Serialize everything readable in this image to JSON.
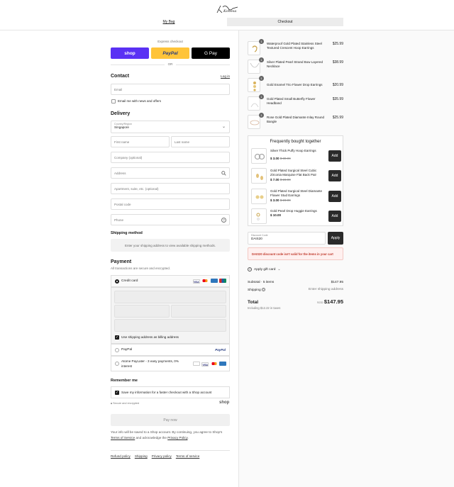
{
  "header": {
    "logo_text": "Kohesa",
    "tab_bag": "My Bag",
    "tab_checkout": "Checkout"
  },
  "express": {
    "title": "Express checkout",
    "shop_label": "shop",
    "paypal_label": "PayPal",
    "gpay_label": "G Pay",
    "or_label": "OR"
  },
  "contact": {
    "title": "Contact",
    "login_link": "Log in",
    "email_placeholder": "Email",
    "news_label": "Email me with news and offers"
  },
  "delivery": {
    "title": "Delivery",
    "country_label": "Country/Region",
    "country_value": "Singapore",
    "first_name": "First name",
    "last_name": "Last name",
    "company": "Company (optional)",
    "address": "Address",
    "apartment": "Apartment, suite, etc. (optional)",
    "postal": "Postal code",
    "phone": "Phone"
  },
  "shipping": {
    "title": "Shipping method",
    "notice": "Enter your shipping address to view available shipping methods."
  },
  "payment": {
    "title": "Payment",
    "subtitle": "All transactions are secure and encrypted.",
    "credit_card": "Credit card",
    "billing_same": "Use shipping address as billing address",
    "paypal": "PayPal",
    "paypal_logo": "PayPal",
    "atome": "Atome PayLater - 3 easy payments, 0% interest"
  },
  "remember": {
    "title": "Remember me",
    "save_label": "Save my information for a faster checkout with a Shop account",
    "secure_note": "Secure and encrypted",
    "shop_logo": "shop"
  },
  "pay_button": "Pay now",
  "legal": {
    "line1": "Your info will be saved to a Shop account. By continuing, you agree to Shop's",
    "terms": "Terms of Service",
    "and": "and acknowledge the",
    "privacy": "Privacy Policy",
    "dot": "."
  },
  "footer": {
    "refund": "Refund policy",
    "shipping": "Shipping",
    "privacy": "Privacy policy",
    "terms": "Terms of service"
  },
  "cart": {
    "items": [
      {
        "qty": "1",
        "name": "Waterproof Gold Plated Stainless Steel Textured Crescent Hoop Earrings",
        "price": "$25.99"
      },
      {
        "qty": "1",
        "name": "Silver Plated Pearl Strand Bow Layered Necklace",
        "price": "$38.99"
      },
      {
        "qty": "1",
        "name": "Gold Enamel Trio Flower Drop Earrings",
        "price": "$20.99"
      },
      {
        "qty": "1",
        "name": "Gold Plated Small Butterfly Flower Headband",
        "price": "$35.99"
      },
      {
        "qty": "1",
        "name": "Rose Gold Plated Diamante Inlay Round Bangle",
        "price": "$25.99"
      }
    ]
  },
  "fbt": {
    "title": "Frequently bought together",
    "add_label": "Add",
    "items": [
      {
        "name": "Silver Thick Puffy Hoop Earrings",
        "price": "$ 3.00",
        "old": "$ 30.99"
      },
      {
        "name": "Gold Plated Surgical Steel Cubic Zirconia Marquise Flat Back Pair",
        "price": "$ 7.00",
        "old": "$ 23.99"
      },
      {
        "name": "Gold Plated Surgical Steel Diamante Flower Stud Earrings",
        "price": "$ 3.00",
        "old": "$ 23.99"
      },
      {
        "name": "Gold Pearl Drop Huggie Earrings",
        "price": "$ 10.00",
        "old": ""
      }
    ]
  },
  "discount": {
    "label": "Discount Code",
    "value": "DAIS20",
    "apply": "Apply",
    "error": "DAIS20 discount code isn't valid for the items in your cart"
  },
  "gift": {
    "label": "Apply gift card"
  },
  "summary": {
    "subtotal_label": "Subtotal · 5 items",
    "subtotal_value": "$147.95",
    "shipping_label": "Shipping",
    "shipping_value": "Enter shipping address",
    "total_label": "Total",
    "currency": "SGD",
    "total_value": "$147.95",
    "taxes": "Including $12.22 in taxes"
  },
  "colors": {
    "shop_purple": "#5a31f4",
    "paypal_yellow": "#ffc439",
    "gpay_black": "#000000",
    "error_red": "#c0392b"
  }
}
